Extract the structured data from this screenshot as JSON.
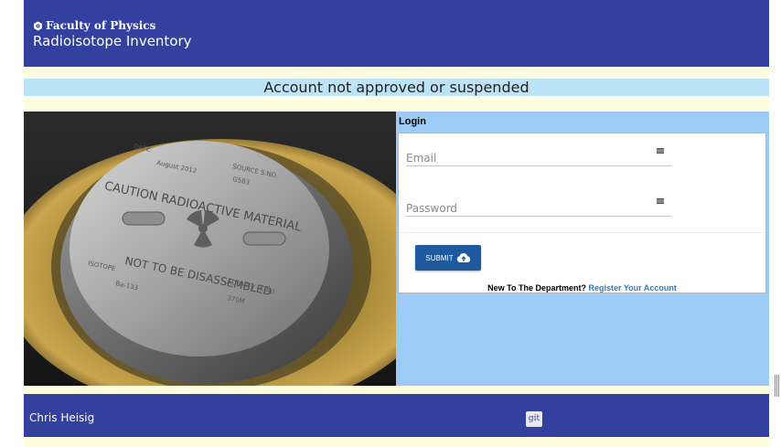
{
  "header": {
    "faculty": "Faculty of Physics",
    "app_title": "Radioisotope Inventory"
  },
  "banner": {
    "message": "Account not approved or suspended"
  },
  "photo": {
    "engraving_lines": [
      "CAUTION  RADIOACTIVE MATERIAL",
      "NOT TO BE DISASSEMBLED"
    ],
    "date_label": "DATE",
    "date_value": "August 2012",
    "source_label": "SOURCE S.NO.",
    "source_value": "G583",
    "isotope_label": "ISOTOPE",
    "isotope_value": "Ba-133",
    "activity_label": "ACTIVITY (KBq)",
    "activity_value": "370M"
  },
  "login": {
    "title": "Login",
    "email_placeholder": "Email",
    "password_placeholder": "Password",
    "submit_label": "SUBMIT",
    "register_prompt": "New To The Department? ",
    "register_link": "Register Your Account"
  },
  "footer": {
    "author": "Chris Heisig",
    "git_label": "git"
  },
  "colors": {
    "header_bg": "#33409e",
    "banner_bg": "#bde3f7",
    "login_panel_bg": "#9ccbf5",
    "submit_bg": "#205a9e",
    "link": "#2d7ec4"
  }
}
